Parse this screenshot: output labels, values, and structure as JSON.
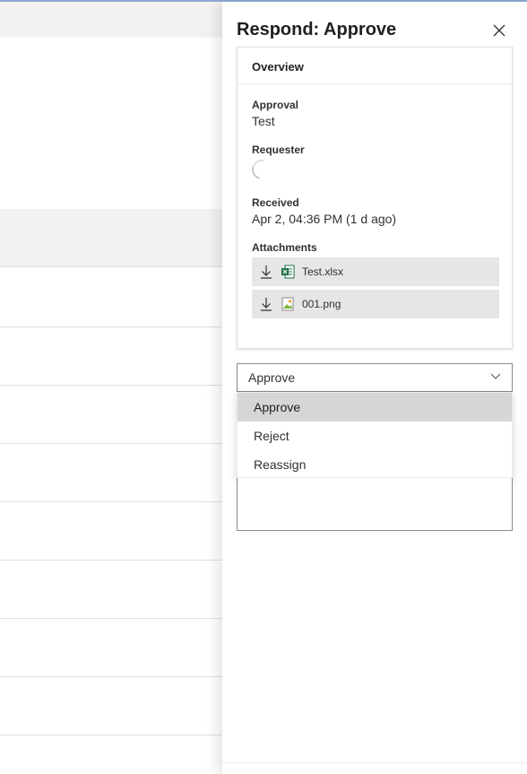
{
  "panel": {
    "title": "Respond: Approve",
    "close_icon": "close-icon"
  },
  "overview": {
    "header": "Overview",
    "approval_label": "Approval",
    "approval_value": "Test",
    "requester_label": "Requester",
    "received_label": "Received",
    "received_value": "Apr 2, 04:36 PM (1 d ago)",
    "attachments_label": "Attachments",
    "attachments": [
      {
        "name": "Test.xlsx",
        "icon": "excel-file-icon"
      },
      {
        "name": "001.png",
        "icon": "image-file-icon"
      }
    ]
  },
  "response": {
    "selected": "Approve",
    "options": [
      "Approve",
      "Reject",
      "Reassign"
    ]
  },
  "colors": {
    "excel_green": "#1e7145",
    "selected_bg": "#d6d6d6"
  }
}
